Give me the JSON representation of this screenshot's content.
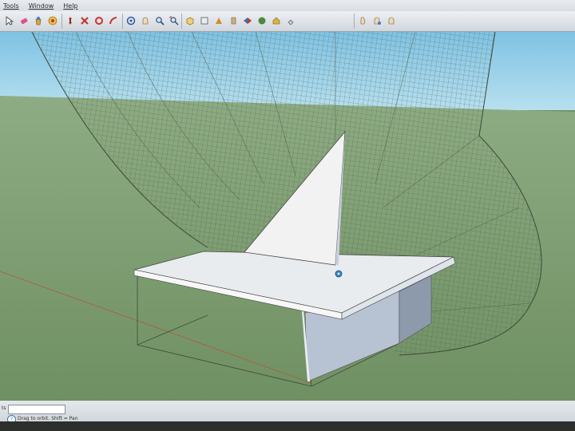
{
  "menu": [
    "Tools",
    "Window",
    "Help"
  ],
  "toolbar": {
    "groups": [
      {
        "name": "drawing-tools",
        "icons": [
          "select-arrow-icon",
          "eraser-icon",
          "paint-bucket-icon",
          "rectangle-icon",
          "push-pull-icon"
        ]
      },
      {
        "name": "modify-tools",
        "icons": [
          "move-icon",
          "rotate-icon",
          "scale-icon",
          "follow-me-icon"
        ]
      },
      {
        "name": "camera-tools",
        "icons": [
          "orbit-icon",
          "pan-icon",
          "zoom-icon",
          "zoom-extents-icon"
        ]
      },
      {
        "name": "view-tools",
        "icons": [
          "iso-view-icon",
          "top-view-icon",
          "front-view-icon",
          "right-view-icon",
          "back-view-icon",
          "left-view-icon",
          "3d-warehouse-icon",
          "components-icon"
        ]
      },
      {
        "name": "walk-tools",
        "icons": [
          "walk-icon",
          "look-around-icon",
          "position-camera-icon"
        ]
      }
    ]
  },
  "colors": {
    "sky": "#9cd3ea",
    "ground": "#86a876",
    "face": "#f2f2f2",
    "face_shadow": "#b9c4d3",
    "grid_line": "#4c5a46",
    "red_axis": "#b5563e",
    "toolbar_bg": "#dfe3e7"
  },
  "status": {
    "measurements_label": "ts",
    "hint": "Drag to orbit.  Shift = Pan"
  }
}
